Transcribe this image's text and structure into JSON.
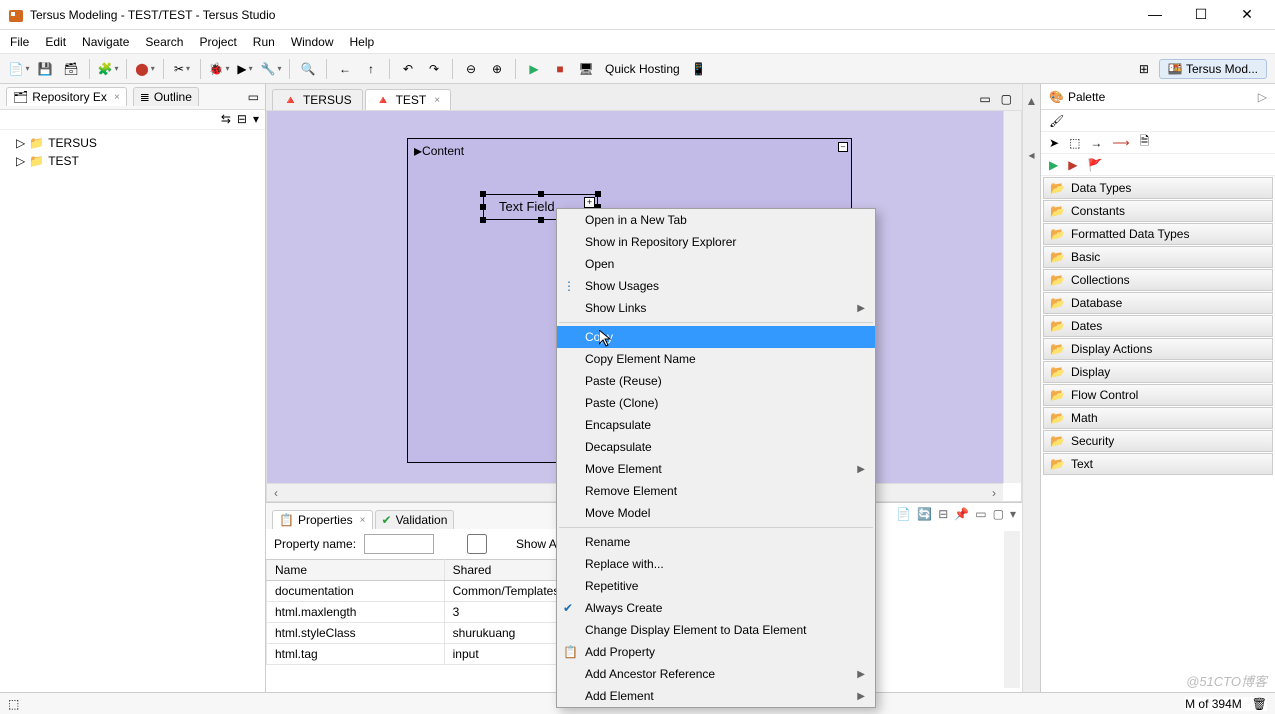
{
  "window": {
    "title": "Tersus Modeling - TEST/TEST - Tersus Studio"
  },
  "menu": [
    "File",
    "Edit",
    "Navigate",
    "Search",
    "Project",
    "Run",
    "Window",
    "Help"
  ],
  "toolbar": {
    "quickHosting": "Quick Hosting",
    "perspective": "Tersus Mod..."
  },
  "leftPane": {
    "repoTab": "Repository Ex",
    "outlineTab": "Outline",
    "tree": [
      "TERSUS",
      "TEST"
    ]
  },
  "editors": {
    "tabs": [
      {
        "label": "TERSUS",
        "active": false
      },
      {
        "label": "TEST",
        "active": true
      }
    ],
    "content": {
      "boxTitle": "Content",
      "fieldLabel": "Text Field"
    }
  },
  "contextMenu": {
    "groups": [
      [
        {
          "label": "Open in a New Tab"
        },
        {
          "label": "Show in Repository Explorer"
        },
        {
          "label": "Open"
        },
        {
          "label": "Show Usages",
          "icon": true
        },
        {
          "label": "Show Links",
          "submenu": true
        }
      ],
      [
        {
          "label": "Copy",
          "selected": true
        },
        {
          "label": "Copy Element Name"
        },
        {
          "label": "Paste (Reuse)"
        },
        {
          "label": "Paste (Clone)"
        },
        {
          "label": "Encapsulate"
        },
        {
          "label": "Decapsulate"
        },
        {
          "label": "Move Element",
          "submenu": true
        },
        {
          "label": "Remove Element"
        },
        {
          "label": "Move Model"
        }
      ],
      [
        {
          "label": "Rename"
        },
        {
          "label": "Replace with..."
        },
        {
          "label": "Repetitive"
        },
        {
          "label": "Always Create",
          "checked": true
        },
        {
          "label": "Change Display Element to Data Element"
        },
        {
          "label": "Add Property",
          "icon": true
        },
        {
          "label": "Add Ancestor Reference",
          "submenu": true
        },
        {
          "label": "Add Element",
          "submenu": true
        }
      ]
    ]
  },
  "palette": {
    "title": "Palette",
    "drawers": [
      "Data Types",
      "Constants",
      "Formatted Data Types",
      "Basic",
      "Collections",
      "Database",
      "Dates",
      "Display Actions",
      "Display",
      "Flow Control",
      "Math",
      "Security",
      "Text"
    ]
  },
  "properties": {
    "tabProps": "Properties",
    "tabValidation": "Validation",
    "filterLabel": "Property name:",
    "showAll": "Show All",
    "columns": [
      "Name",
      "Shared"
    ],
    "rows": [
      {
        "name": "documentation",
        "shared": "Common/Templates/Display/Text I..."
      },
      {
        "name": "html.maxlength",
        "shared": "3"
      },
      {
        "name": "html.styleClass",
        "shared": "shurukuang"
      },
      {
        "name": "html.tag",
        "shared": "input"
      }
    ]
  },
  "status": {
    "memory": "M of 394M"
  },
  "watermark": "@51CTO博客"
}
